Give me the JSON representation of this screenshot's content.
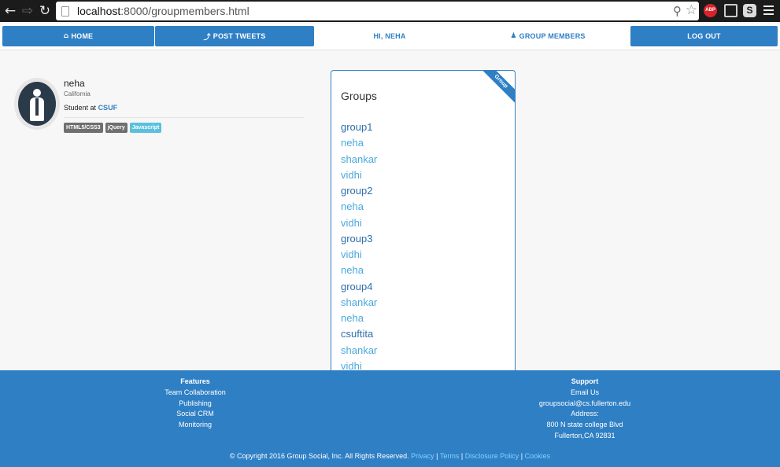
{
  "browser": {
    "url_host": "localhost",
    "url_rest": ":8000/groupmembers.html",
    "abp_label": "ABP",
    "skype_label": "S"
  },
  "nav": {
    "home": "HOME",
    "post_tweets": "POST TWEETS",
    "greeting": "HI, NEHA",
    "group_members": "GROUP MEMBERS",
    "logout": "LOG OUT"
  },
  "profile": {
    "name": "neha",
    "location": "California",
    "study_prefix": "Student at",
    "school": "CSUF",
    "tags": [
      "HTML5/CSS3",
      "jQuery",
      "Javascript"
    ]
  },
  "groups_panel": {
    "ribbon": "Group",
    "title": "Groups",
    "items": [
      {
        "text": "group1",
        "kind": "group"
      },
      {
        "text": "neha",
        "kind": "member"
      },
      {
        "text": "shankar",
        "kind": "member"
      },
      {
        "text": "vidhi",
        "kind": "member"
      },
      {
        "text": "group2",
        "kind": "group"
      },
      {
        "text": "neha",
        "kind": "member"
      },
      {
        "text": "vidhi",
        "kind": "member"
      },
      {
        "text": "group3",
        "kind": "group"
      },
      {
        "text": "vidhi",
        "kind": "member"
      },
      {
        "text": "neha",
        "kind": "member"
      },
      {
        "text": "group4",
        "kind": "group"
      },
      {
        "text": "shankar",
        "kind": "member"
      },
      {
        "text": "neha",
        "kind": "member"
      },
      {
        "text": "csuftita",
        "kind": "group"
      },
      {
        "text": "shankar",
        "kind": "member"
      },
      {
        "text": "vidhi",
        "kind": "member"
      }
    ]
  },
  "footer": {
    "features_heading": "Features",
    "features": [
      "Team Collaboration",
      "Publishing",
      "Social CRM",
      "Monitoring"
    ],
    "support_heading": "Support",
    "support": [
      "Email Us",
      "groupsocial@cs.fullerton.edu",
      "Address:",
      "800 N state college Blvd",
      "Fullerton,CA 92831"
    ],
    "copyright": "© Copyright 2016 Group Social, Inc. All Rights Reserved.",
    "links": [
      "Privacy",
      "Terms",
      "Disclosure Policy",
      "Cookies"
    ],
    "separator": "|"
  },
  "colors": {
    "brand_blue": "#2f7fc4",
    "member_link": "#4aa8dc",
    "group_link": "#2f6ea9"
  }
}
